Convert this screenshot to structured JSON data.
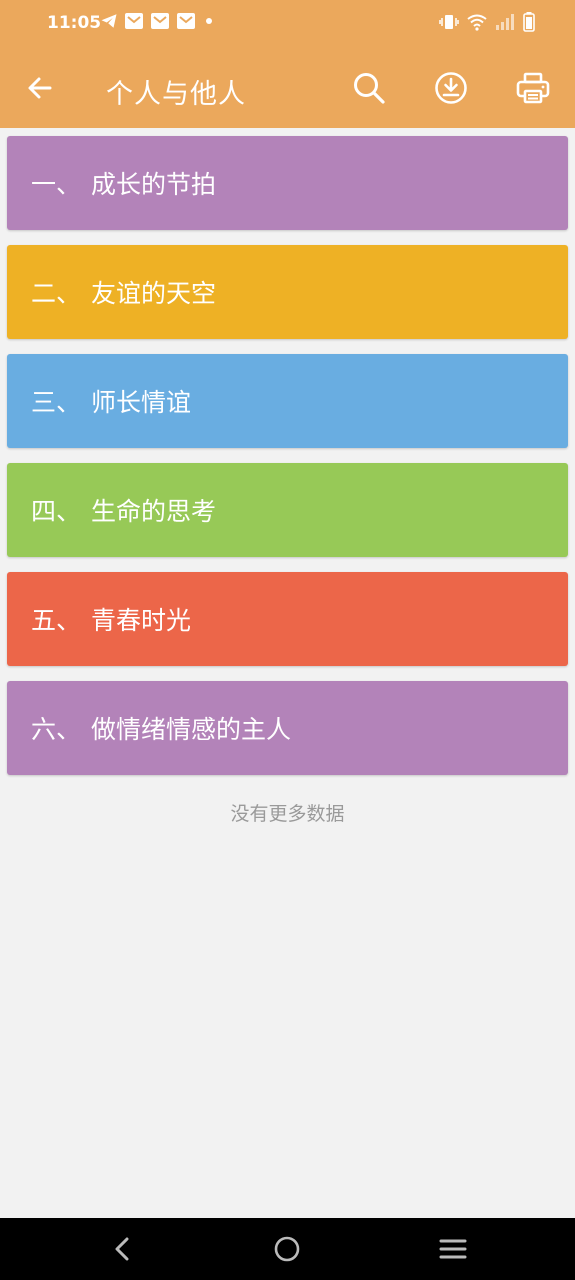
{
  "status_bar": {
    "time": "11:05",
    "left_icons": [
      "telegram-icon",
      "mail-icon",
      "mail-icon",
      "mail-icon",
      "dot-icon"
    ],
    "right_icons": [
      "vibrate-icon",
      "wifi-icon",
      "signal-icon",
      "battery-icon"
    ]
  },
  "toolbar": {
    "title": "个人与他人",
    "actions": [
      "search-icon",
      "download-icon",
      "print-icon"
    ]
  },
  "colors": {
    "appbar": "#eba85c",
    "background": "#f2f2f2"
  },
  "items": [
    {
      "num": "一、",
      "label": "成长的节拍",
      "color": "#b383b9"
    },
    {
      "num": "二、",
      "label": "友谊的天空",
      "color": "#eeb125"
    },
    {
      "num": "三、",
      "label": "师长情谊",
      "color": "#69ade1"
    },
    {
      "num": "四、",
      "label": "生命的思考",
      "color": "#97c957"
    },
    {
      "num": "五、",
      "label": "青春时光",
      "color": "#ec6649"
    },
    {
      "num": "六、",
      "label": "做情绪情感的主人",
      "color": "#b383b9"
    }
  ],
  "footer_text": "没有更多数据",
  "nav_bar": [
    "back-icon",
    "home-icon",
    "menu-icon"
  ]
}
